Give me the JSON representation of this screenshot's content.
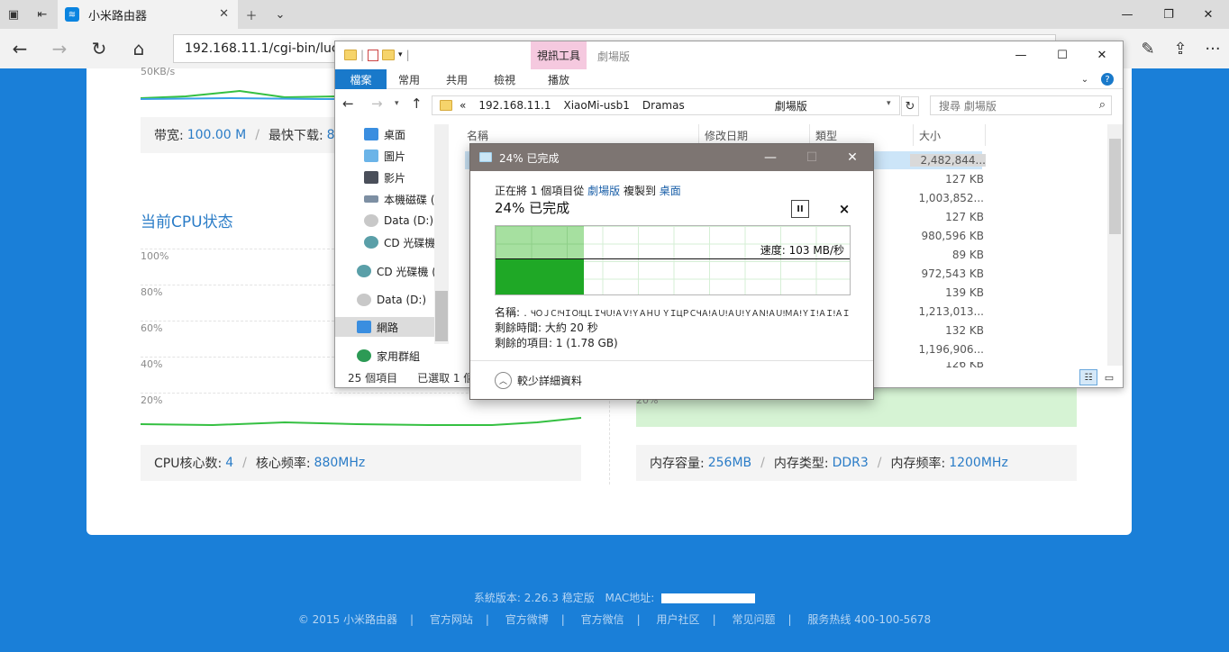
{
  "browser": {
    "tab_title": "小米路由器",
    "url": "192.168.11.1/cgi-bin/luci/;s"
  },
  "page": {
    "net_speed_label": "50KB/s",
    "bandwidth_label": "带宽:",
    "bandwidth_value": "100.00 M",
    "max_download_label": "最快下载:",
    "max_download_value": "8.4",
    "cpu_title": "当前CPU状态",
    "cpu_axis": [
      "100%",
      "80%",
      "60%",
      "40%",
      "20%"
    ],
    "mem_axis_20": "20%",
    "cpu_cores_label": "CPU核心数:",
    "cpu_cores_value": "4",
    "cpu_freq_label": "核心频率:",
    "cpu_freq_value": "880MHz",
    "mem_size_label": "内存容量:",
    "mem_size_value": "256MB",
    "mem_type_label": "内存类型:",
    "mem_type_value": "DDR3",
    "mem_freq_label": "内存频率:",
    "mem_freq_value": "1200MHz"
  },
  "footer": {
    "version": "系統版本: 2.26.3 稳定版",
    "mac_label": "MAC地址:",
    "links": [
      "© 2015 小米路由器",
      "官方网站",
      "官方微博",
      "官方微信",
      "用户社区",
      "常见问题",
      "服务热线 400-100-5678"
    ]
  },
  "explorer": {
    "context_tab": "視訊工具",
    "window_title": "劇場版",
    "ribbon_tabs": [
      "檔案",
      "常用",
      "共用",
      "檢視",
      "播放"
    ],
    "breadcrumb": [
      "«",
      "192.168.11.1",
      "XiaoMi-usb1",
      "Dramas",
      "劇場版"
    ],
    "search_placeholder": "搜尋 劇場版",
    "nav_items": [
      "桌面",
      "圖片",
      "影片",
      "本機磁碟 (",
      "Data (D:)",
      "CD 光碟機",
      "CD 光碟機 (",
      "Data (D:)",
      "網路",
      "家用群組"
    ],
    "columns": [
      "名稱",
      "修改日期",
      "類型",
      "大小"
    ],
    "sizes": [
      "2,482,844...",
      "127 KB",
      "1,003,852...",
      "127 KB",
      "980,596 KB",
      "89 KB",
      "972,543 KB",
      "139 KB",
      "1,213,013...",
      "132 KB",
      "1,196,906...",
      "126 KB"
    ],
    "status_count": "25 個項目",
    "status_selected": "已選取 1 個"
  },
  "dialog": {
    "title": "24% 已完成",
    "line1_pre": "正在將 1 個項目從",
    "line1_src": "劇場版",
    "line1_mid": "複製到",
    "line1_dst": "桌面",
    "big_status": "24% 已完成",
    "pause_icon": "II",
    "cancel_icon": "×",
    "speed": "速度: 103 MB/秒",
    "progress_fraction": 0.25,
    "name_label": "名稱:",
    "name_value": "．ЧＯＪＣ!ЧＩＯ!ЦＬＩЧＵ!ＡＶ!ＹＡＨＵ ＹＩЦＰＣЧＡ!ＡＵ!ＡＵ!ＹＡＮ!ＡＵ!ＭＡ!ＹＩ!ＡＩ!ＡＩ．}ｆ．．．",
    "remaining_time": "剩餘時間: 大約 20 秒",
    "remaining_items": "剩餘的項目: 1 (1.78 GB)",
    "details_button": "較少詳細資料"
  },
  "colors": {
    "page_bg": "#1a7fd8",
    "accent": "#2a7cc7",
    "progress_green": "#1fa826"
  }
}
